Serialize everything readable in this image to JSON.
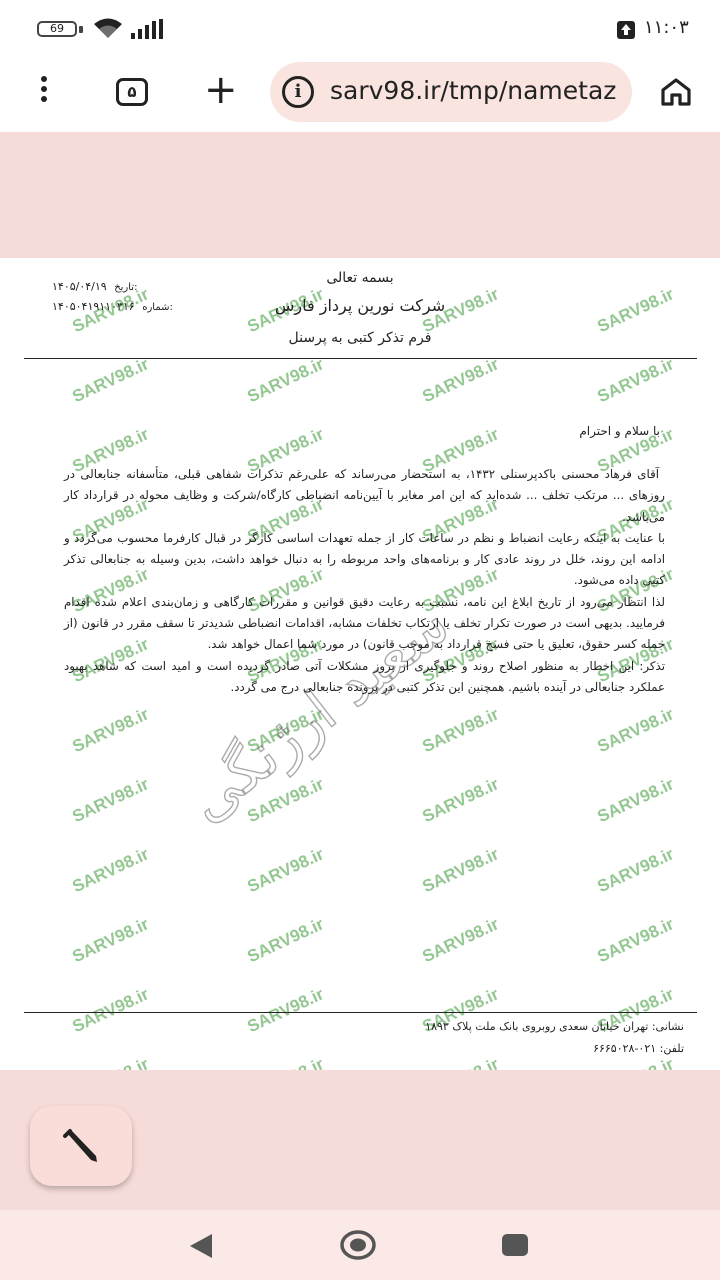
{
  "status_bar": {
    "battery": "69",
    "time": "۱۱:۰۳"
  },
  "browser": {
    "tab_count": "۵",
    "url": "sarv98.ir/tmp/nametaz",
    "new_tab_symbol": "+"
  },
  "document": {
    "basmala": "بسمه تعالی",
    "company": "شرکت نورین پرداز فارس",
    "form_title": "فرم تذکر کتبی به پرسنل",
    "date_label": "تاریخ:",
    "date_value": "۱۴۰۵/۰۴/۱۹",
    "number_label": "شماره:",
    "number_value": "۱۴۰۵۰۴۱۹۱۱۰۳۱۶",
    "greeting": "با سلام و احترام",
    "paragraphs": [
      "آقای فرهاد محسنی باکدپرسنلی ۱۴۳۲، به استحضار می‌رساند که علی‌رغم تذکرات شفاهی قبلی، متأسفانه جنابعالی در روزهای ... مرتکب تخلف ... شده‌اید که این امر مغایر با آیین‌نامه انضباطی کارگاه/شرکت و وظایف محوله در قرارداد کار می‌باشد.",
      "با عنایت به اینکه رعایت انضباط و نظم در ساعات کار از جمله تعهدات اساسی کارگر در قبال کارفرما محسوب می‌گردد و ادامه این روند، خلل در روند عادی کار و برنامه‌های واحد مربوطه را به دنبال خواهد داشت، بدین وسیله به جنابعالی تذکر کتبی داده می‌شود.",
      "لذا انتظار می‌رود از تاریخ ابلاغ این نامه، نسبت به رعایت دقیق قوانین و مقررات کارگاهی و زمان‌بندی اعلام شده اقدام فرمایید. بدیهی است در صورت تکرار تخلف یا ارتکاب تخلفات مشابه، اقدامات انضباطی شدیدتر تا سقف مقرر در قانون (از جمله کسر حقوق، تعلیق یا حتی فسخ قرارداد به موجب قانون) در مورد شما اعمال خواهد شد.",
      "تذکر: این اخطار به منظور اصلاح روند و جلوگیری از بروز مشکلات آتی صادر گردیده است و امید است که شاهد بهبود عملکرد جنابعالی در آینده باشیم. همچنین این تذکر کتبی در پرونده جنابعالی درج می گردد."
    ],
    "address": "نشانی: تهران خیابان سعدی روبروی بانک ملت پلاک ۱۸۹۳",
    "phone": "تلفن: ۰۲۱-۶۶۶۵۰۲۸",
    "watermark_text": "SARV98.ir",
    "signature_text": "سعید ارژنگی"
  },
  "colors": {
    "watermark": "#3f9a3a",
    "accent_bg": "#f6dcd8",
    "text": "#222222"
  },
  "icons": [
    "menu-dots-icon",
    "tabs-icon",
    "plus-icon",
    "info-icon",
    "home-icon",
    "pencil-icon",
    "back-icon",
    "home-circle-icon",
    "recent-apps-icon",
    "wifi-icon",
    "signal-icon",
    "upload-icon"
  ]
}
